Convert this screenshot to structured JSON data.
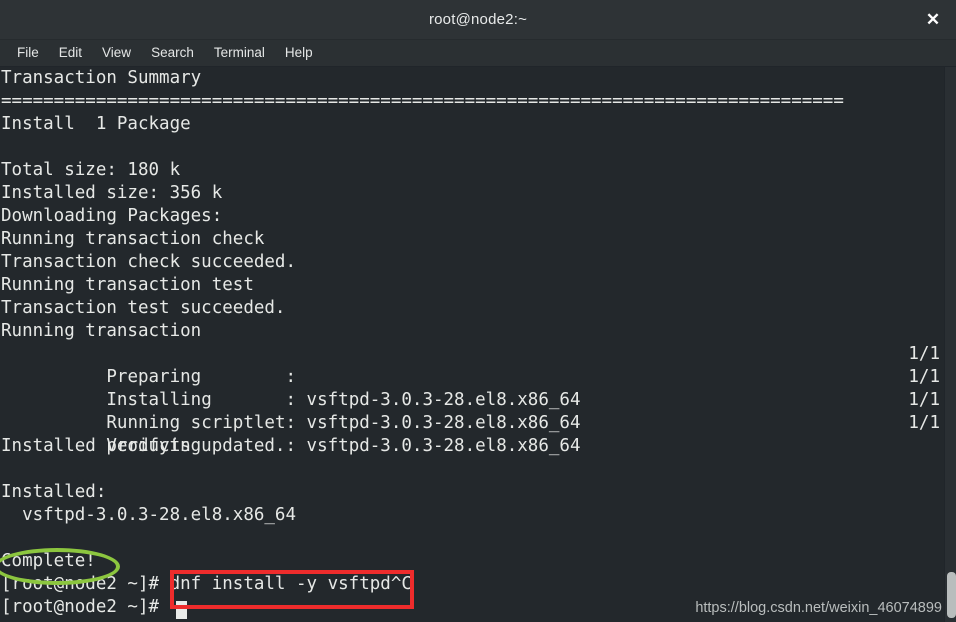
{
  "window": {
    "title": "root@node2:~",
    "close_icon": "close-icon",
    "close_label": "✕"
  },
  "menubar": {
    "items": [
      {
        "label": "File"
      },
      {
        "label": "Edit"
      },
      {
        "label": "View"
      },
      {
        "label": "Search"
      },
      {
        "label": "Terminal"
      },
      {
        "label": "Help"
      }
    ]
  },
  "terminal": {
    "lines": [
      {
        "text": "Transaction Summary"
      },
      {
        "text": "================================================================================",
        "rule": true
      },
      {
        "text": "Install  1 Package"
      },
      {
        "text": ""
      },
      {
        "text": "Total size: 180 k"
      },
      {
        "text": "Installed size: 356 k"
      },
      {
        "text": "Downloading Packages:"
      },
      {
        "text": "Running transaction check"
      },
      {
        "text": "Transaction check succeeded."
      },
      {
        "text": "Running transaction test"
      },
      {
        "text": "Transaction test succeeded."
      },
      {
        "text": "Running transaction"
      },
      {
        "text": "  Preparing        :",
        "count": "1/1"
      },
      {
        "text": "  Installing       : vsftpd-3.0.3-28.el8.x86_64",
        "count": "1/1"
      },
      {
        "text": "  Running scriptlet: vsftpd-3.0.3-28.el8.x86_64",
        "count": "1/1"
      },
      {
        "text": "  Verifying        : vsftpd-3.0.3-28.el8.x86_64",
        "count": "1/1"
      },
      {
        "text": "Installed products updated."
      },
      {
        "text": ""
      },
      {
        "text": "Installed:"
      },
      {
        "text": "  vsftpd-3.0.3-28.el8.x86_64"
      },
      {
        "text": ""
      },
      {
        "text": "Complete!"
      },
      {
        "text": "[root@node2 ~]# dnf install -y vsftpd^C"
      },
      {
        "text": "[root@node2 ~]# "
      }
    ],
    "prompt": "[root@node2 ~]#",
    "command": "dnf install -y vsftpd",
    "interrupt": "^C",
    "package": "vsftpd-3.0.3-28.el8.x86_64"
  },
  "annotations": {
    "ellipse": {
      "target": "Complete!",
      "color": "#8cc63f"
    },
    "rectangle": {
      "target": "dnf install -y vsftpd",
      "color": "#ee2c2c"
    }
  },
  "watermark": {
    "text": "https://blog.csdn.net/weixin_46074899"
  },
  "colors": {
    "terminal_bg": "#23282c",
    "titlebar_bg": "#2e3336",
    "menubar_bg": "#2b3033",
    "text": "#e6e8e6",
    "annot_green": "#8cc63f",
    "annot_red": "#ee2c2c"
  }
}
